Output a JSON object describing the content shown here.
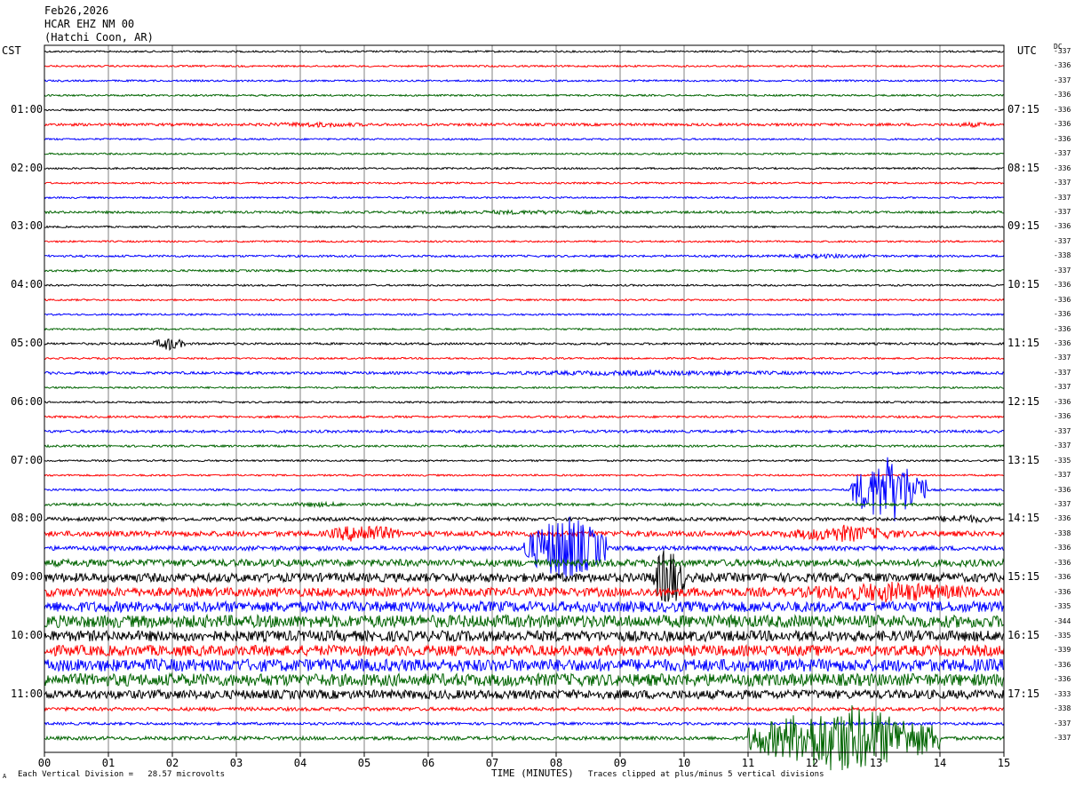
{
  "header": {
    "date": "Feb26,2026",
    "station": "HCAR EHZ NM 00",
    "location": "(Hatchi Coon, AR)"
  },
  "left_zone_label": "CST",
  "right_zone_label": "UTC",
  "dc_label": "DC",
  "footer": {
    "scale_note": "Each Vertical Division =   28.57 microvolts",
    "clip_note": "Traces clipped at plus/minus 5 vertical divisions",
    "corner_mark": "A"
  },
  "chart_data": {
    "type": "line",
    "xlabel": "TIME (MINUTES)",
    "xlim": [
      0,
      15
    ],
    "x_ticks": [
      "00",
      "01",
      "02",
      "03",
      "04",
      "05",
      "06",
      "07",
      "08",
      "09",
      "10",
      "11",
      "12",
      "13",
      "14",
      "15"
    ],
    "trace_colors": [
      "#000000",
      "#ff0000",
      "#0000ff",
      "#006400"
    ],
    "left_time_labels": [
      {
        "row": 4,
        "label": "01:00"
      },
      {
        "row": 8,
        "label": "02:00"
      },
      {
        "row": 12,
        "label": "03:00"
      },
      {
        "row": 16,
        "label": "04:00"
      },
      {
        "row": 20,
        "label": "05:00"
      },
      {
        "row": 24,
        "label": "06:00"
      },
      {
        "row": 28,
        "label": "07:00"
      },
      {
        "row": 32,
        "label": "08:00"
      },
      {
        "row": 36,
        "label": "09:00"
      },
      {
        "row": 40,
        "label": "10:00"
      },
      {
        "row": 44,
        "label": "11:00"
      }
    ],
    "right_time_labels": [
      {
        "row": 4,
        "label": "07:15"
      },
      {
        "row": 8,
        "label": "08:15"
      },
      {
        "row": 12,
        "label": "09:15"
      },
      {
        "row": 16,
        "label": "10:15"
      },
      {
        "row": 20,
        "label": "11:15"
      },
      {
        "row": 24,
        "label": "12:15"
      },
      {
        "row": 28,
        "label": "13:15"
      },
      {
        "row": 32,
        "label": "14:15"
      },
      {
        "row": 36,
        "label": "15:15"
      },
      {
        "row": 40,
        "label": "16:15"
      },
      {
        "row": 44,
        "label": "17:15"
      }
    ],
    "dc_offsets": [
      "-337",
      "-336",
      "-337",
      "-336",
      "-336",
      "-336",
      "-336",
      "-337",
      "-336",
      "-337",
      "-337",
      "-337",
      "-336",
      "-337",
      "-338",
      "-337",
      "-336",
      "-336",
      "-336",
      "-336",
      "-336",
      "-337",
      "-337",
      "-337",
      "-336",
      "-336",
      "-337",
      "-337",
      "-335",
      "-337",
      "-336",
      "-337",
      "-336",
      "-338",
      "-336",
      "-336",
      "-336",
      "-336",
      "-335",
      "-344",
      "-335",
      "-339",
      "-336",
      "-336",
      "-333",
      "-338",
      "-337",
      "-337"
    ],
    "trace_amplitude": [
      1,
      1,
      1,
      1,
      1,
      1.5,
      1,
      1,
      1,
      1,
      1,
      1.3,
      1,
      1,
      1.2,
      1.2,
      1,
      1,
      1,
      1,
      1.2,
      1,
      1.5,
      1,
      1,
      1.2,
      1.5,
      1.2,
      1,
      1,
      1.2,
      1.5,
      2,
      3,
      2.5,
      4,
      5,
      5,
      6,
      7,
      6,
      6,
      7,
      7,
      5,
      2,
      1.5,
      2
    ],
    "events": [
      {
        "row": 5,
        "start_min": 3.0,
        "end_min": 5.5,
        "amp": 3
      },
      {
        "row": 5,
        "start_min": 14.0,
        "end_min": 15.0,
        "amp": 3
      },
      {
        "row": 11,
        "start_min": 5.0,
        "end_min": 10.0,
        "amp": 2.5
      },
      {
        "row": 14,
        "start_min": 11.0,
        "end_min": 13.5,
        "amp": 2.5
      },
      {
        "row": 20,
        "start_min": 1.7,
        "end_min": 2.2,
        "amp": 8
      },
      {
        "row": 22,
        "start_min": 5.5,
        "end_min": 13.5,
        "amp": 3
      },
      {
        "row": 30,
        "start_min": 12.6,
        "end_min": 13.8,
        "amp": 40
      },
      {
        "row": 31,
        "start_min": 3.5,
        "end_min": 5.0,
        "amp": 3
      },
      {
        "row": 32,
        "start_min": 13.7,
        "end_min": 15.0,
        "amp": 5
      },
      {
        "row": 33,
        "start_min": 4.4,
        "end_min": 5.6,
        "amp": 12
      },
      {
        "row": 33,
        "start_min": 11.5,
        "end_min": 13.5,
        "amp": 10
      },
      {
        "row": 34,
        "start_min": 7.5,
        "end_min": 8.8,
        "amp": 40
      },
      {
        "row": 36,
        "start_min": 9.5,
        "end_min": 10.0,
        "amp": 40
      },
      {
        "row": 37,
        "start_min": 11.5,
        "end_min": 15.0,
        "amp": 12
      },
      {
        "row": 47,
        "start_min": 11.0,
        "end_min": 14.0,
        "amp": 40
      }
    ]
  }
}
